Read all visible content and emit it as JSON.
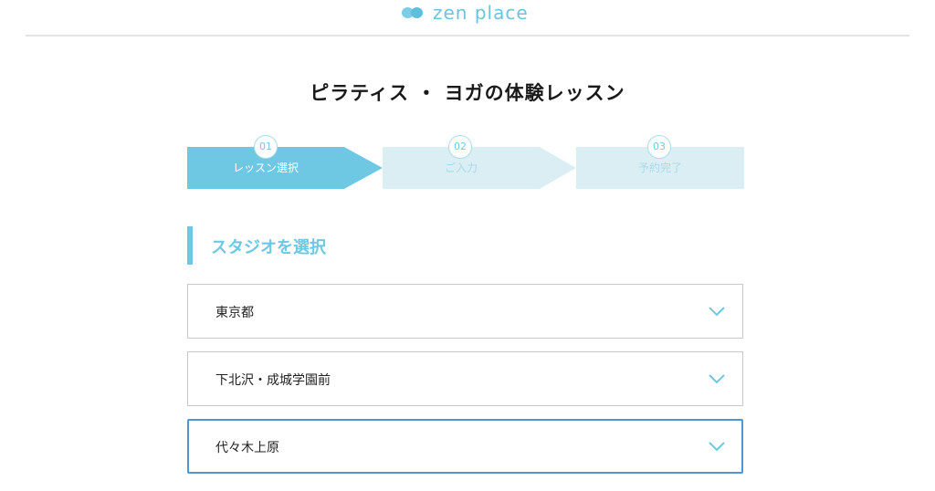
{
  "header": {
    "brand": "zen place"
  },
  "page": {
    "title": "ピラティス ・ ヨガの体験レッスン"
  },
  "steps": [
    {
      "number": "01",
      "label": "レッスン選択",
      "active": true
    },
    {
      "number": "02",
      "label": "ご入力",
      "active": false
    },
    {
      "number": "03",
      "label": "予約完了",
      "active": false
    }
  ],
  "section": {
    "heading": "スタジオを選択"
  },
  "selects": [
    {
      "value": "東京都"
    },
    {
      "value": "下北沢・成城学園前"
    },
    {
      "value": "代々木上原"
    }
  ],
  "colors": {
    "accent": "#6ec8e4",
    "step_active": "#6ec8e4",
    "step_inactive": "#dbeef4",
    "focus_border": "#4f97d3"
  }
}
